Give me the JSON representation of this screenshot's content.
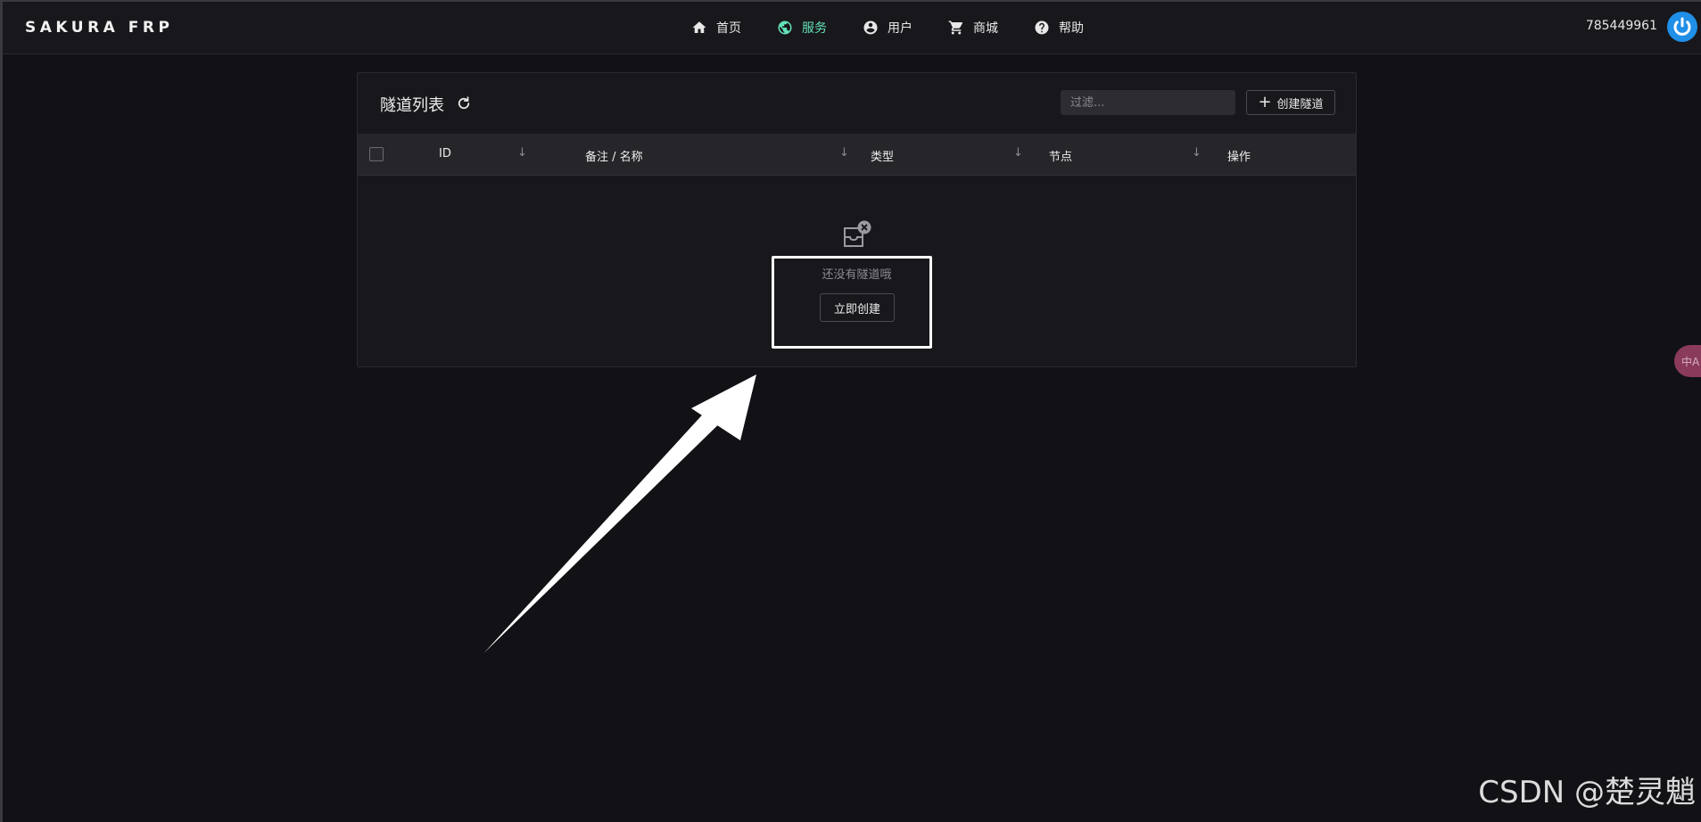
{
  "brand": "SAKURA FRP",
  "nav": [
    {
      "label": "首页",
      "icon": "home-icon"
    },
    {
      "label": "服务",
      "icon": "globe-icon",
      "active": true
    },
    {
      "label": "用户",
      "icon": "user-icon"
    },
    {
      "label": "商城",
      "icon": "cart-icon"
    },
    {
      "label": "帮助",
      "icon": "help-icon"
    }
  ],
  "user": {
    "id": "785449961",
    "avatar_icon": "power-icon"
  },
  "tunnels": {
    "title": "隧道列表",
    "filter_placeholder": "过滤...",
    "create_label": "创建隧道",
    "columns": [
      "ID",
      "备注 / 名称",
      "类型",
      "节点",
      "操作"
    ],
    "empty_text": "还没有隧道哦",
    "create_now_label": "立即创建"
  },
  "lang_bubble": "中A",
  "watermark": "CSDN @楚灵魈",
  "colors": {
    "accent": "#63e2b7",
    "power": "#1f8fe8",
    "background": "#111116",
    "panel": "#18181c"
  }
}
